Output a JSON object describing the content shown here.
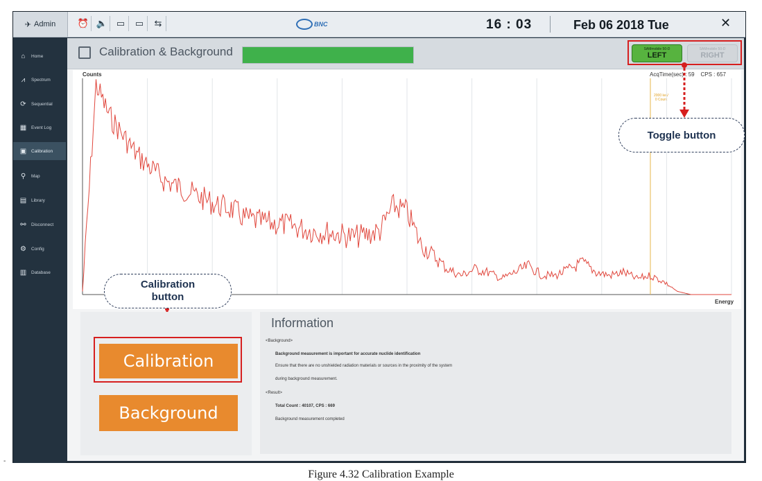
{
  "topbar": {
    "user": "Admin",
    "icons": [
      "alarm-clock-icon",
      "speaker-icon",
      "battery-1-icon",
      "battery-2-icon",
      "usb-icon"
    ],
    "brand": "BNC",
    "time": "16 : 03",
    "date": "Feb 06 2018 Tue",
    "close_glyph": "✕"
  },
  "sidebar": {
    "items": [
      {
        "label": "Home",
        "icon": "home-icon"
      },
      {
        "label": "Spectrum",
        "icon": "spectrum-icon"
      },
      {
        "label": "Sequential",
        "icon": "sequential-icon"
      },
      {
        "label": "Event Log",
        "icon": "event-log-icon"
      },
      {
        "label": "Calibration",
        "icon": "calibration-icon",
        "active": true
      },
      {
        "label": "Map",
        "icon": "map-icon"
      },
      {
        "label": "Library",
        "icon": "library-icon"
      },
      {
        "label": "Disconnect",
        "icon": "disconnect-icon"
      },
      {
        "label": "Config",
        "icon": "config-icon"
      },
      {
        "label": "Database",
        "icon": "database-icon"
      }
    ]
  },
  "main": {
    "title": "Calibration & Background",
    "progress_percent": 100,
    "toggle": {
      "left_small": "SAMmobile 50-D",
      "left_big": "LEFT",
      "right_small": "SAMmobile 50-D",
      "right_big": "RIGHT"
    }
  },
  "chart": {
    "ylabel": "Counts",
    "xlabel": "Energy",
    "acq_label": "AcqTime(sec) : 59",
    "cps_label": "CPS : 657",
    "roi_line1": "2000 keV",
    "roi_line2": "0 Count"
  },
  "chart_data": {
    "type": "line",
    "title": "",
    "xlabel": "Energy",
    "ylabel": "Counts",
    "x": [
      0,
      20,
      40,
      60,
      80,
      100,
      120,
      140,
      160,
      180,
      200,
      220,
      240,
      260,
      280,
      300,
      320,
      340,
      360,
      380,
      400,
      420,
      440,
      460,
      480,
      500,
      520,
      540,
      560,
      580,
      600,
      620,
      640,
      660,
      680,
      700,
      720,
      740,
      760,
      780,
      800,
      820,
      840,
      860,
      880,
      900,
      920,
      940,
      960
    ],
    "values": [
      5,
      330,
      280,
      250,
      220,
      200,
      180,
      170,
      160,
      150,
      140,
      135,
      120,
      115,
      112,
      110,
      105,
      100,
      98,
      95,
      90,
      94,
      100,
      140,
      130,
      80,
      60,
      40,
      30,
      40,
      35,
      25,
      35,
      45,
      30,
      30,
      40,
      50,
      35,
      30,
      35,
      25,
      30,
      20,
      5,
      0,
      0,
      0,
      0
    ],
    "series": [
      {
        "name": "",
        "color": "#e0463c"
      }
    ],
    "grid": true
  },
  "callouts": {
    "toggle": "Toggle button",
    "calibration_line1": "Calibration",
    "calibration_line2": "button"
  },
  "buttons": {
    "calibration": "Calibration",
    "background": "Background"
  },
  "info": {
    "title": "Information",
    "lines": [
      "<Background>",
      "Background measurement is important for accurate nuclide identification",
      "Ensure that there are no unshielded radiation materials or sources in the proximity of the system",
      "during background measurement.",
      "<Result>",
      "Total Count : 40107, CPS : 669",
      "Background measurement completed"
    ]
  },
  "caption": "Figure 4.32  Calibration Example",
  "colors": {
    "accent_orange": "#e88a2e",
    "active_green": "#57b33f",
    "highlight_red": "#d61f1f",
    "sidebar_bg": "#23323f"
  }
}
